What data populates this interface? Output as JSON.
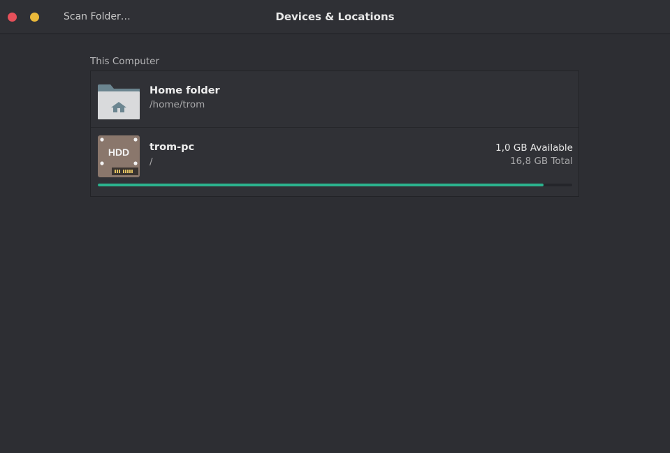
{
  "window": {
    "title": "Devices & Locations",
    "scan_button_label": "Scan Folder…"
  },
  "section": {
    "label": "This Computer"
  },
  "locations": [
    {
      "name": "Home folder",
      "path": "/home/trom",
      "icon": "home-folder-icon"
    },
    {
      "name": "trom-pc",
      "path": "/",
      "icon": "hdd-icon",
      "icon_text": "HDD",
      "available": "1,0 GB Available",
      "total": "16,8 GB Total",
      "used_fraction": 0.94
    }
  ],
  "colors": {
    "close": "#e6505a",
    "minimize": "#ebb93a",
    "usage_bar": "#2bb38e",
    "background": "#2d2e33"
  }
}
